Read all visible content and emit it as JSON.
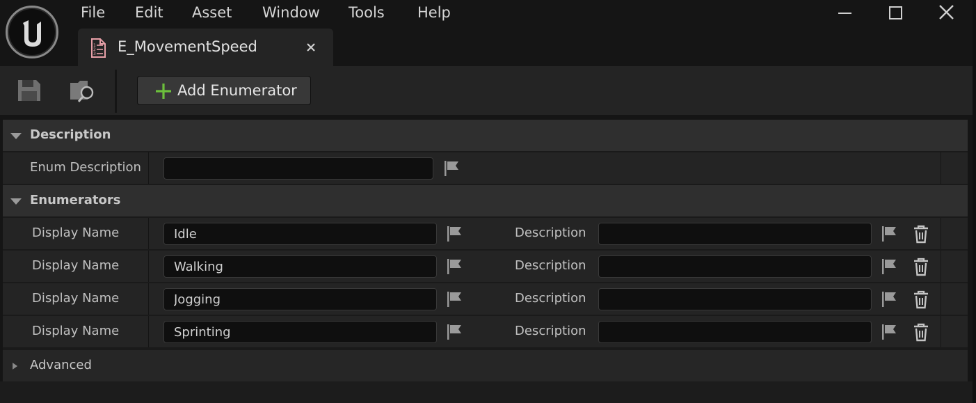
{
  "menu": {
    "items": [
      "File",
      "Edit",
      "Asset",
      "Window",
      "Tools",
      "Help"
    ]
  },
  "tab": {
    "title": "E_MovementSpeed",
    "close_label": "×"
  },
  "toolbar": {
    "add_enumerator_label": "Add Enumerator",
    "icons": [
      "save-icon",
      "browse-asset-icon",
      "plus-icon"
    ]
  },
  "details": {
    "description_category": "Description",
    "enum_description_label": "Enum Description",
    "enum_description_value": "",
    "enumerators_category": "Enumerators",
    "enumerators": [
      {
        "display_name_label": "Display Name",
        "display_name": "Idle",
        "description_label": "Description",
        "description": ""
      },
      {
        "display_name_label": "Display Name",
        "display_name": "Walking",
        "description_label": "Description",
        "description": ""
      },
      {
        "display_name_label": "Display Name",
        "display_name": "Jogging",
        "description_label": "Description",
        "description": ""
      },
      {
        "display_name_label": "Display Name",
        "display_name": "Sprinting",
        "description_label": "Description",
        "description": ""
      }
    ],
    "advanced_category": "Advanced"
  },
  "colors": {
    "accent_green": "#6cbf3c",
    "selection_blue": "#0070e0",
    "tab_icon_pink": "#e8a0a8"
  }
}
